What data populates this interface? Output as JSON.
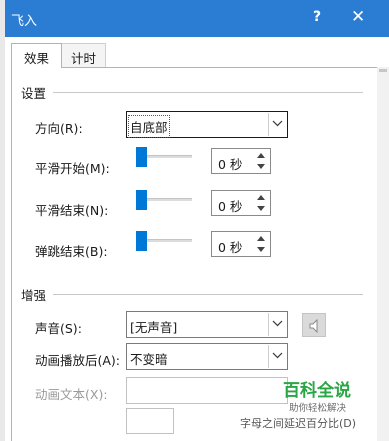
{
  "window": {
    "title": "飞入",
    "help_label": "?",
    "close_label": "✕",
    "title_color": "#2b7cd3"
  },
  "tabs": [
    {
      "label": "效果",
      "selected": true
    },
    {
      "label": "计时",
      "selected": false
    }
  ],
  "settings": {
    "section_label": "设置",
    "direction": {
      "label": "方向(R):",
      "value": "自底部"
    },
    "smooth_start": {
      "label": "平滑开始(M):",
      "value": "0 秒",
      "slider_fraction": 0
    },
    "smooth_end": {
      "label": "平滑结束(N):",
      "value": "0 秒",
      "slider_fraction": 0
    },
    "bounce_end": {
      "label": "弹跳结束(B):",
      "value": "0 秒",
      "slider_fraction": 0
    }
  },
  "enhancements": {
    "section_label": "增强",
    "sound": {
      "label": "声音(S):",
      "value": "[无声音]",
      "icon": "speaker-icon"
    },
    "after_animation": {
      "label": "动画播放后(A):",
      "value": "不变暗"
    },
    "animate_text": {
      "label": "动画文本(X):",
      "value": "",
      "enabled": false
    },
    "text_delay": {
      "value": "",
      "enabled": false
    }
  },
  "watermark": {
    "brand": "百科全说",
    "slogan": "助你轻松解决",
    "hint": "字母之间延迟百分比(D)"
  },
  "colors": {
    "accent": "#0078d7",
    "watermark": "#29a645"
  }
}
